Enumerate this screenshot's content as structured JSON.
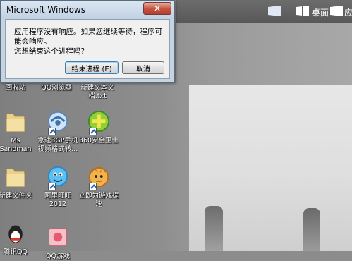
{
  "dialog": {
    "title": "Microsoft Windows",
    "close_symbol": "✕",
    "message_line1": "应用程序没有响应。如果您继续等待，程序可能会响应。",
    "message_line2": "您想结束这个进程吗?",
    "end_button": "结束进程 (E)",
    "cancel_button": "取消"
  },
  "topbar": {
    "desktop_label": "桌面",
    "apps_label": "应"
  },
  "desktop_icons": {
    "recycle_bin": "回收站",
    "qq_browser": "QQ浏览器",
    "new_text_doc": "新建文本文档.txt",
    "ms_sandman": "Ms Sandman",
    "video_converter": "急速3GP手机视频格式转...",
    "safe_360": "360安全卫士",
    "new_folder": "新建文件夹",
    "aliwangwang": "阿里旺旺2012",
    "game_box": "立即为游戏提速",
    "qq": "腾讯QQ",
    "qq_game": "QQ游戏"
  },
  "colors": {
    "accent_close": "#c4523e",
    "dialog_frame": "#c5d3e3",
    "desktop_photo": "#e0e0e0"
  },
  "icons": [
    "windows-flag-icon",
    "folder-icon",
    "browser-icon",
    "shield-icon",
    "bird-icon",
    "tiger-icon",
    "penguin-icon",
    "shortcut-arrow-icon"
  ]
}
